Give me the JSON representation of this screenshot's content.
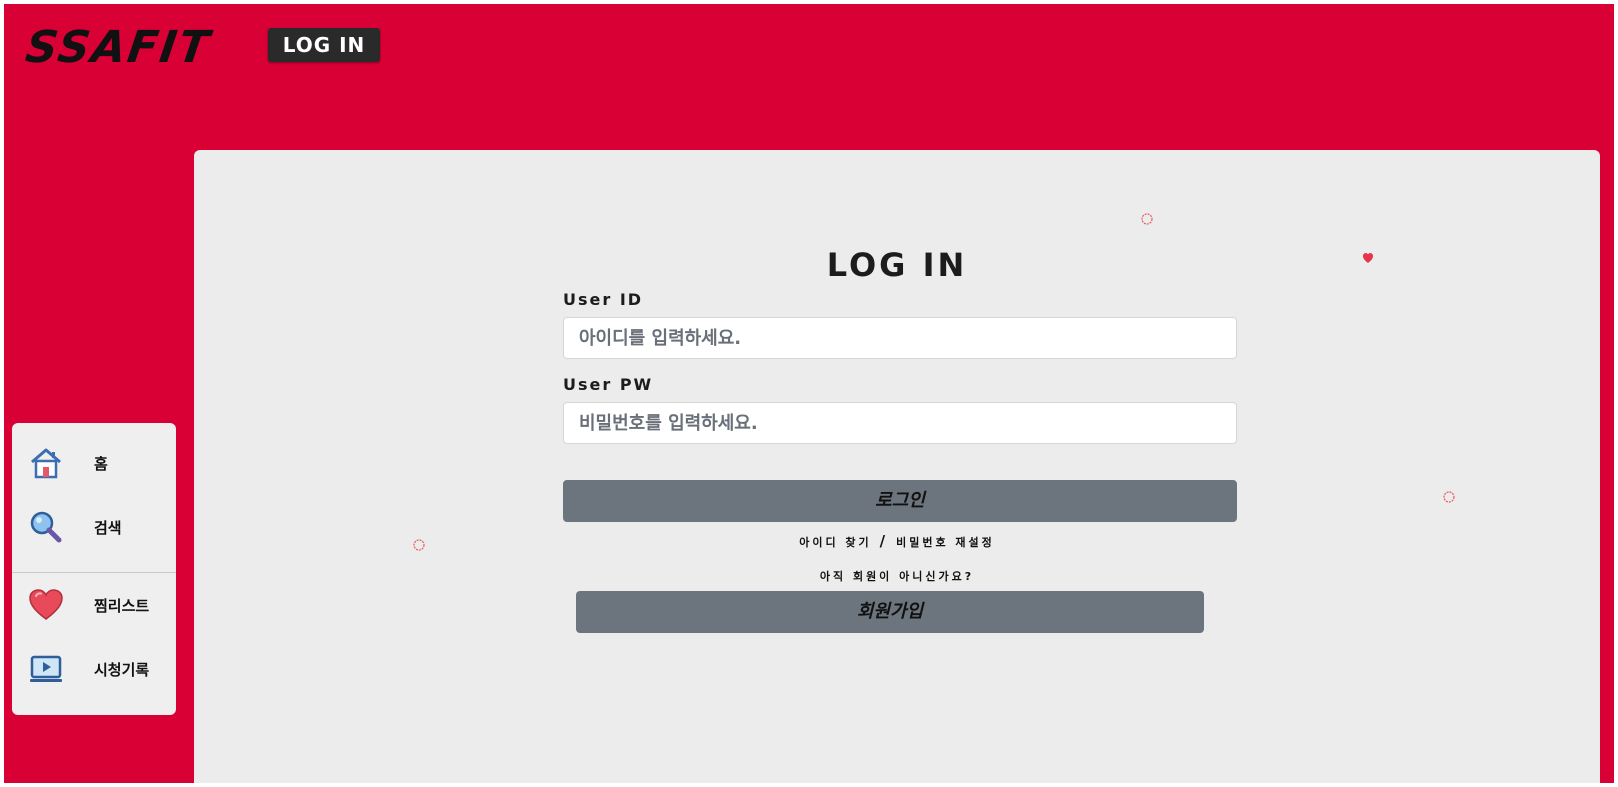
{
  "header": {
    "logo": "SSAFIT",
    "page_badge": "LOG IN"
  },
  "sidebar": {
    "items": [
      {
        "label": "홈",
        "icon": "home-icon"
      },
      {
        "label": "검색",
        "icon": "search-icon"
      },
      {
        "label": "찜리스트",
        "icon": "heart-icon"
      },
      {
        "label": "시청기록",
        "icon": "play-video-icon"
      }
    ]
  },
  "login": {
    "title": "LOG IN",
    "id_label": "User ID",
    "id_placeholder": "아이디를 입력하세요.",
    "pw_label": "User PW",
    "pw_placeholder": "비밀번호를 입력하세요.",
    "login_button": "로그인",
    "find_id_link": "아이디 찾기",
    "separator": "/",
    "reset_pw_link": "비밀번호 재설정",
    "signup_prompt": "아직 회원이 아니신가요?",
    "signup_button": "회원가입"
  },
  "colors": {
    "brand_red": "#d90036",
    "panel_bg": "#ececec",
    "button_gray": "#6c757d",
    "badge_dark": "#2a2a2a"
  }
}
